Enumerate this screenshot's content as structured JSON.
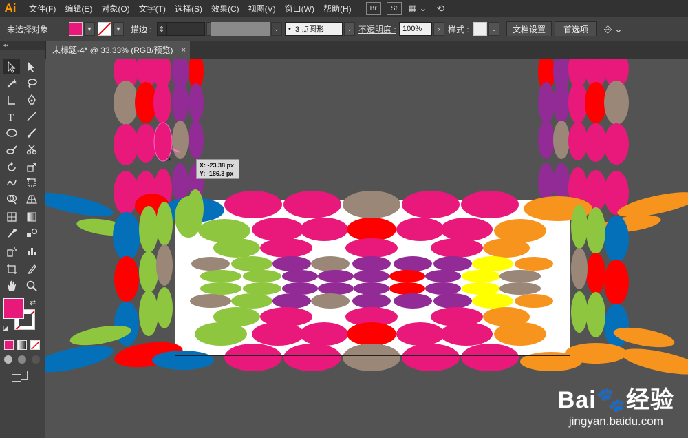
{
  "app": {
    "logo": "Ai"
  },
  "menu": [
    "文件(F)",
    "编辑(E)",
    "对象(O)",
    "文字(T)",
    "选择(S)",
    "效果(C)",
    "视图(V)",
    "窗口(W)",
    "帮助(H)"
  ],
  "menu_badges": [
    "Br",
    "St"
  ],
  "control": {
    "selection_status": "未选择对象",
    "fill_color": "#e8197a",
    "stroke_label": "描边 :",
    "brush_label": "3 点圆形",
    "opacity_label": "不透明度 :",
    "opacity_value": "100%",
    "style_label": "样式 :",
    "doc_setup_button": "文档设置",
    "preferences_button": "首选项"
  },
  "tab": {
    "title": "未标题-4* @ 33.33% (RGB/预览)",
    "close": "×"
  },
  "readout": {
    "x": "X: -23.38 px",
    "y": "Y: -186.3 px"
  },
  "watermark": {
    "logo": "Bai🐾经验",
    "url": "jingyan.baidu.com"
  },
  "colors": {
    "pink": "#e8197a",
    "red": "#ff0000",
    "tan": "#9b8777",
    "purple": "#922b95",
    "blue": "#0470b9",
    "green": "#8ec63f",
    "orange": "#f7941d",
    "yellow": "#ffff00"
  },
  "icons": [
    "selection-tool-icon",
    "direct-selection-tool-icon",
    "magic-wand-icon",
    "lasso-icon",
    "pen-icon",
    "type-icon",
    "line-icon",
    "ellipse-icon",
    "brush-icon",
    "blob-brush-icon",
    "scissors-icon",
    "rotate-icon",
    "scale-icon",
    "warp-icon",
    "free-transform-icon",
    "shape-builder-icon",
    "perspective-icon",
    "mesh-icon",
    "gradient-icon",
    "eyedropper-icon",
    "blend-icon",
    "symbol-sprayer-icon",
    "graph-icon",
    "artboard-icon",
    "slice-icon",
    "hand-icon",
    "zoom-icon"
  ]
}
